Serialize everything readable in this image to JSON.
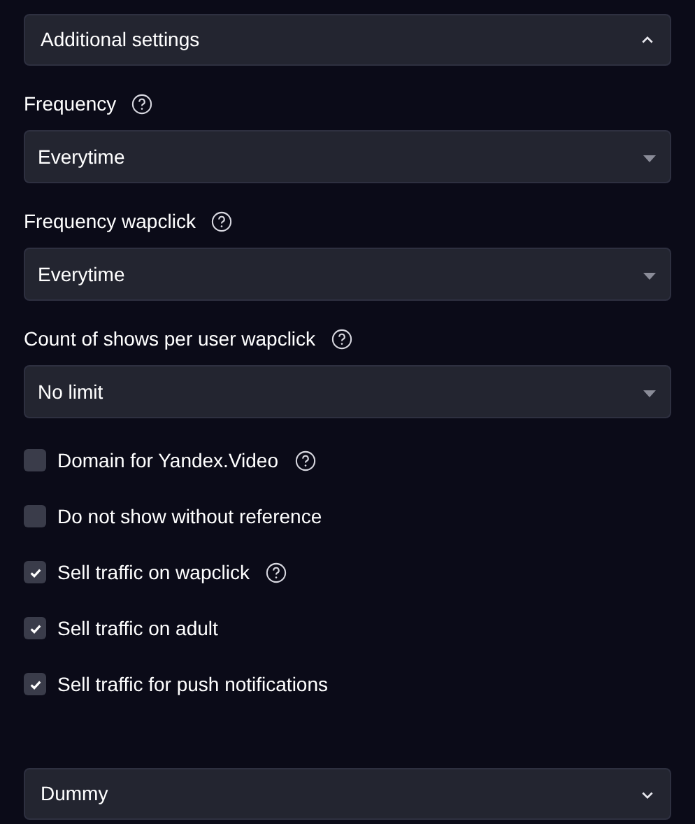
{
  "sections_top": {
    "title": "Additional settings",
    "expanded": true
  },
  "selects": [
    {
      "label": "Frequency",
      "help": true,
      "value": "Everytime"
    },
    {
      "label": "Frequency wapclick",
      "help": true,
      "value": "Everytime"
    },
    {
      "label": "Count of shows per user wapclick",
      "help": true,
      "value": "No limit"
    }
  ],
  "checkboxes": [
    {
      "label": "Domain for Yandex.Video",
      "checked": false,
      "help": true
    },
    {
      "label": "Do not show without reference",
      "checked": false,
      "help": false
    },
    {
      "label": "Sell traffic on wapclick",
      "checked": true,
      "help": true
    },
    {
      "label": "Sell traffic on adult",
      "checked": true,
      "help": false
    },
    {
      "label": "Sell traffic for push notifications",
      "checked": true,
      "help": false
    }
  ],
  "sections_bottom": {
    "title": "Dummy",
    "expanded": false
  }
}
